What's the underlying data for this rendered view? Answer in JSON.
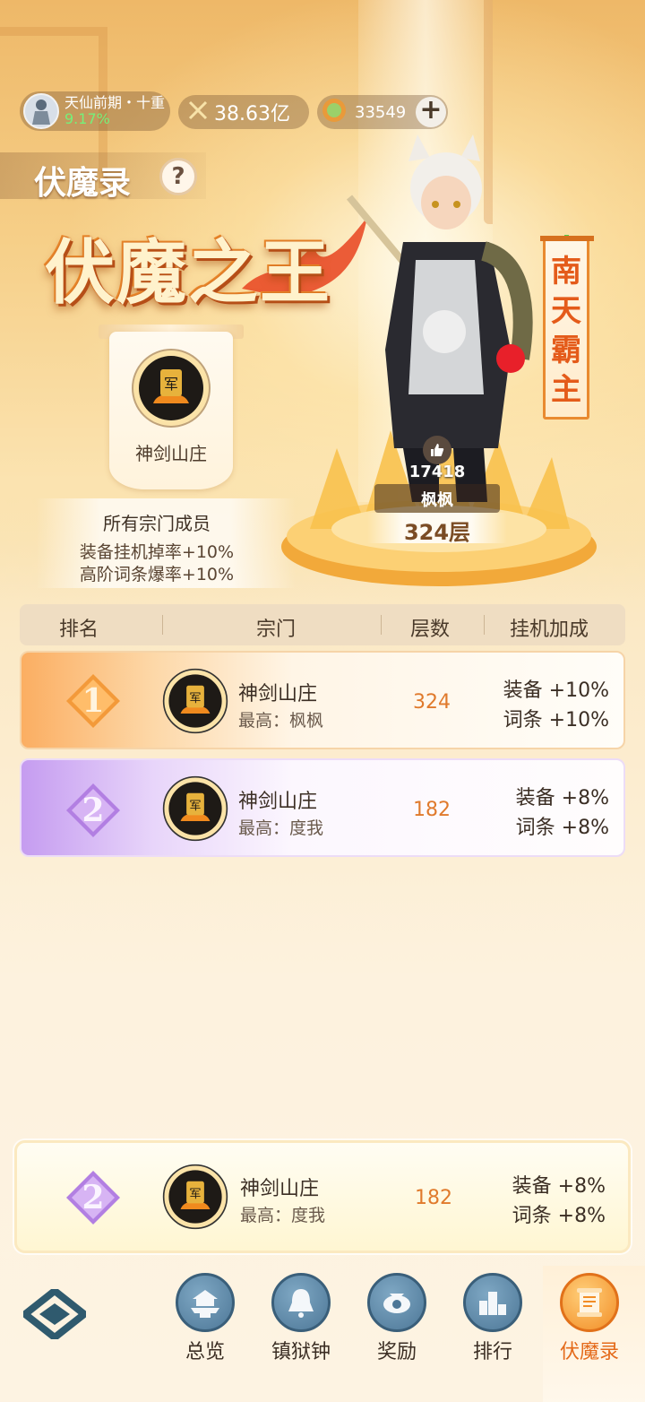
{
  "status": {
    "realm_name": "天仙前期・十重",
    "realm_progress": "9.17%",
    "combat_power": "38.63亿",
    "currency": "33549",
    "add_symbol": "+"
  },
  "page_title": "伏魔录",
  "help_symbol": "?",
  "logo_text": "伏魔之王",
  "emblem_glyph": "军",
  "champion": {
    "sect_name": "神剑山庄",
    "bonus_title": "所有宗门成员",
    "bonus_lines": [
      "装备挂机掉率+10%",
      "高阶词条爆率+10%"
    ],
    "likes": "17418",
    "player_name": "枫枫",
    "floor": "324层",
    "title_chars": [
      "南",
      "天",
      "霸",
      "主"
    ]
  },
  "table": {
    "headers": [
      "排名",
      "宗门",
      "层数",
      "挂机加成"
    ],
    "rows": [
      {
        "rank": "1",
        "sect": "神剑山庄",
        "top_player": "最高：枫枫",
        "floor": "324",
        "equip_bonus": "装备 +10%",
        "affix_bonus": "词条 +10%"
      },
      {
        "rank": "2",
        "sect": "神剑山庄",
        "top_player": "最高：度我",
        "floor": "182",
        "equip_bonus": "装备 +8%",
        "affix_bonus": "词条 +8%"
      }
    ]
  },
  "my_sect": {
    "rank": "2",
    "sect": "神剑山庄",
    "top_player": "最高：度我",
    "floor": "182",
    "equip_bonus": "装备 +8%",
    "affix_bonus": "词条 +8%"
  },
  "nav": [
    {
      "label": "总览",
      "icon": "pagoda-icon"
    },
    {
      "label": "镇狱钟",
      "icon": "bell-icon"
    },
    {
      "label": "奖励",
      "icon": "reward-icon"
    },
    {
      "label": "排行",
      "icon": "ranking-icon"
    },
    {
      "label": "伏魔录",
      "icon": "scroll-icon",
      "active": true
    }
  ],
  "colors": {
    "accent": "#e46a1a",
    "rank1": "#f7a449",
    "rank2": "#b886e8",
    "floor": "#e07a2c",
    "realm_pct": "#76f07a"
  }
}
